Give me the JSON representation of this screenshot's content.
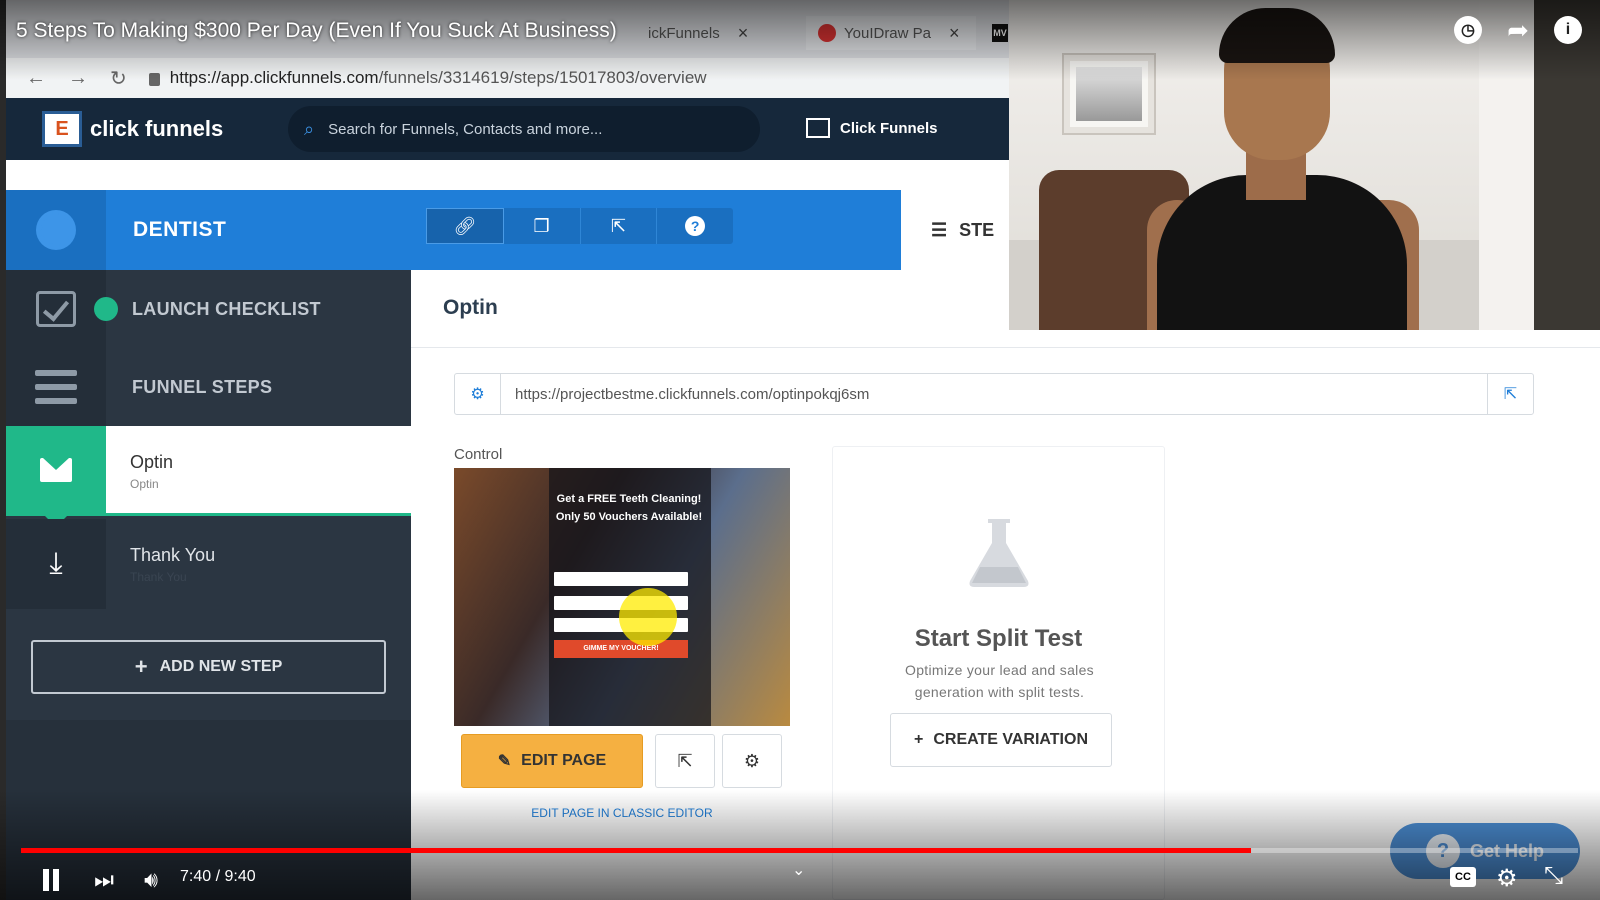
{
  "video": {
    "title": "5 Steps To Making $300 Per Day (Even If You Suck At Business)",
    "time": "7:40 / 9:40",
    "progress": 0.79
  },
  "browser": {
    "tabs": [
      {
        "label": "ickFunnels",
        "icon": "clickfunnels-favicon"
      },
      {
        "label": "YouIDraw Pa",
        "icon": "youidraw-favicon"
      },
      {
        "label": "MV",
        "icon": "mv-favicon"
      }
    ],
    "url_host": "https://app.clickfunnels.com",
    "url_path": "/funnels/3314619/steps/15017803/overview"
  },
  "cf": {
    "logo_text": "click funnels",
    "search_placeholder": "Search for Funnels, Contacts and more...",
    "brand_link": "Click Funnels"
  },
  "funnel": {
    "name": "DENTIST",
    "tools": [
      "link-icon",
      "copy-icon",
      "external-link-icon",
      "help-icon"
    ],
    "steps_tab": "STE"
  },
  "sidebar": {
    "launch_checklist": "LAUNCH CHECKLIST",
    "funnel_steps": "FUNNEL STEPS",
    "steps": [
      {
        "title": "Optin",
        "subtitle": "Optin",
        "active": true
      },
      {
        "title": "Thank You",
        "subtitle": "Thank You",
        "active": false
      }
    ],
    "add_step": "ADD NEW STEP"
  },
  "main": {
    "page_title": "Optin",
    "page_url": "https://projectbestme.clickfunnels.com/optinpokqj6sm",
    "control_label": "Control",
    "thumbnail": {
      "headline1": "Get a FREE Teeth Cleaning!",
      "headline2": "Only 50 Vouchers Available!",
      "cta": "GIMME MY VOUCHER!"
    },
    "edit_page": "EDIT PAGE",
    "classic_editor": "EDIT PAGE IN CLASSIC EDITOR",
    "split": {
      "title": "Start Split Test",
      "desc": "Optimize your lead and sales generation with split tests.",
      "button": "CREATE VARIATION"
    }
  },
  "help_widget": "Get Help",
  "colors": {
    "cf_blue": "#1f7ed8",
    "cf_green": "#20b889",
    "cf_navy": "#16283b",
    "edit_orange": "#f5b041",
    "yt_red": "#ff0000"
  }
}
